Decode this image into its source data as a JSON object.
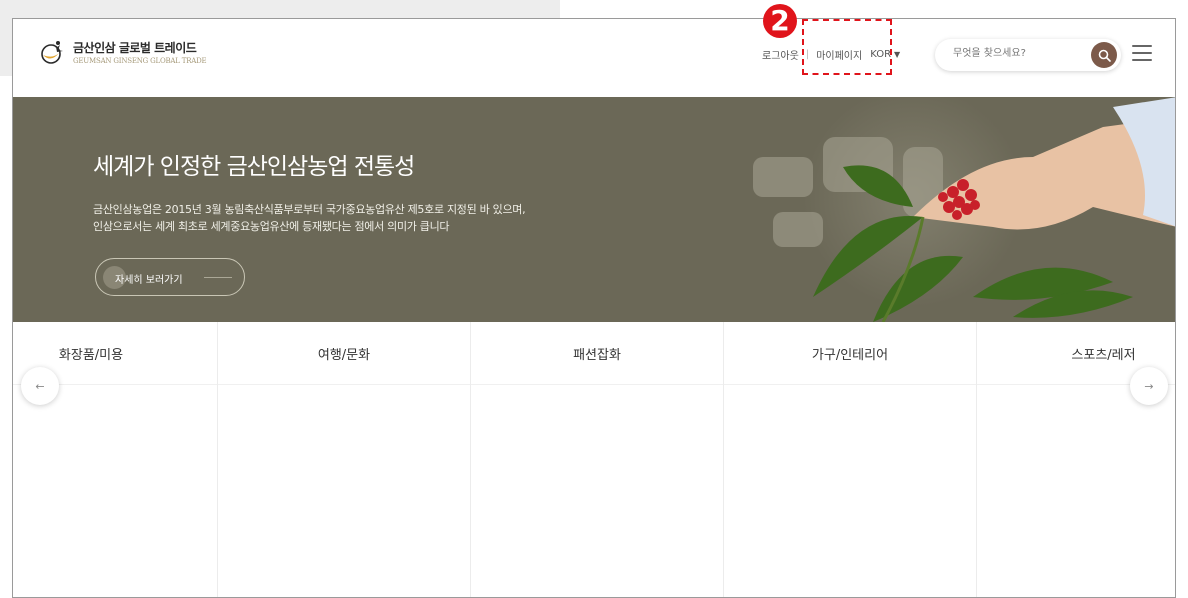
{
  "header": {
    "logo_ko": "금산인삼 글로벌 트레이드",
    "logo_en": "GEUMSAN GINSENG GLOBAL TRADE",
    "logout": "로그아웃",
    "mypage": "마이페이지",
    "lang": "KOR",
    "search_placeholder": "무엇을 찾으세요?"
  },
  "hero": {
    "title": "세계가 인정한 금산인삼농업 전통성",
    "desc_line1": "금산인삼농업은 2015년 3월 농림축산식품부로부터 국가중요농업유산 제5호로 지정된 바 있으며,",
    "desc_line2": "인삼으로서는 세계 최초로 세계중요농업유산에 등재됐다는 점에서 의미가 큽니다",
    "button": "자세히 보러가기"
  },
  "categories": [
    "화장품/미용",
    "여행/문화",
    "패션잡화",
    "가구/인테리어",
    "스포츠/레저"
  ],
  "arrows": {
    "prev": "←",
    "next": "→"
  },
  "annotation": {
    "number": "2"
  },
  "colors": {
    "hero_bg": "#6b6857",
    "brand_brown": "#7c5a4a",
    "annotation_red": "#e0141b"
  }
}
